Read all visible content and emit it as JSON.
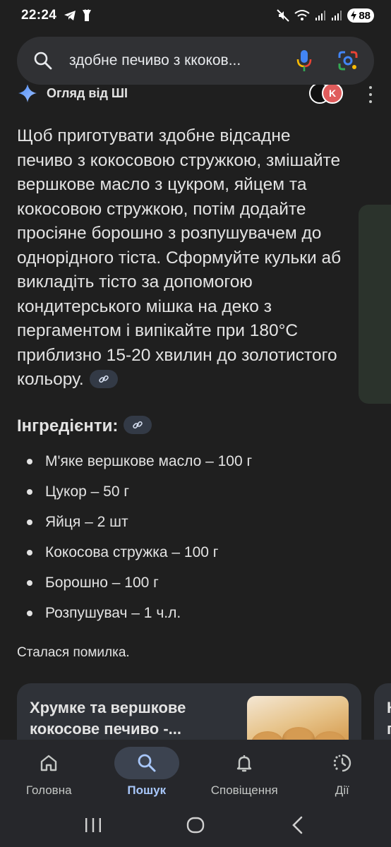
{
  "status_bar": {
    "time": "22:24",
    "battery": "88",
    "left_icons": [
      "telegram-icon",
      "flashlight-icon"
    ],
    "right_icons": [
      "mute-icon",
      "wifi-icon",
      "signal-icon",
      "signal-icon",
      "battery-icon"
    ]
  },
  "search": {
    "query": "здобне печиво з ккоков...",
    "icons": [
      "search-icon",
      "mic-icon",
      "lens-icon"
    ]
  },
  "ai_overview": {
    "title": "Огляд від ШІ",
    "paragraph_lines": [
      "Щоб приготувати здобне відсадне",
      "печиво з кокосовою стружкою, змішайте",
      "вершкове масло з цукром, яйцем та",
      "кокосовою стружкою, потім додайте",
      "просіяне борошно з розпушувачем до",
      "однорідного тіста. Сформуйте кульки аб",
      "викладіть тісто за допомогою",
      "кондитерського мішка на деко з",
      "пергаментом і випікайте при 180°C",
      "приблизно 15-20 хвилин до золотистого",
      "кольору."
    ]
  },
  "ingredients": {
    "title": "Інгредієнти:",
    "items": [
      "М'яке вершкове масло – 100 г",
      "Цукор – 50 г",
      "Яйця – 2 шт",
      "Кокосова стружка – 100 г",
      "Борошно – 100 г",
      "Розпушувач – 1 ч.л."
    ]
  },
  "error_message": "Сталася помилка.",
  "result_card": {
    "title_line1": "Хрумке та вершкове",
    "title_line2": "кокосове печиво -...",
    "peek_line1": "К",
    "peek_line2": "п"
  },
  "bottom_nav": {
    "items": [
      {
        "label": "Головна",
        "icon": "home-icon",
        "active": false
      },
      {
        "label": "Пошук",
        "icon": "search-icon",
        "active": true
      },
      {
        "label": "Сповіщення",
        "icon": "bell-icon",
        "active": false
      },
      {
        "label": "Дії",
        "icon": "activity-icon",
        "active": false
      }
    ]
  },
  "system_nav": [
    "recents-icon",
    "home-circle-icon",
    "back-icon"
  ],
  "colors": {
    "background": "#1f1f1f",
    "search_bar": "#303134",
    "link_chip": "#333a46",
    "active_nav": "#a8c7fa"
  }
}
